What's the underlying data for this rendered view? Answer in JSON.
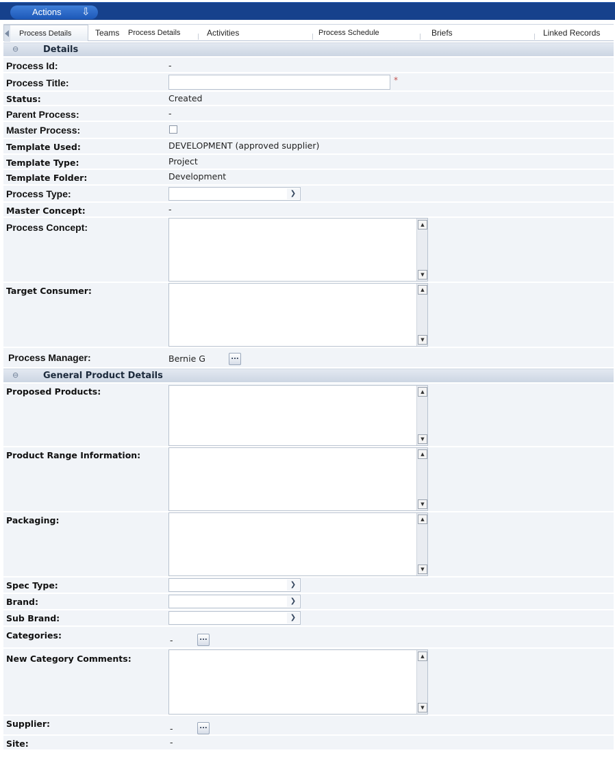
{
  "toolbar": {
    "actions_label": "Actions",
    "actions_icon": "down-arrow-icon"
  },
  "tabs": [
    {
      "label": "Process Details",
      "active": true
    },
    {
      "label": "Teams"
    },
    {
      "label": "Process Details"
    },
    {
      "label": "Activities"
    },
    {
      "label": "Process Schedule"
    },
    {
      "label": "Briefs"
    },
    {
      "label": "Linked Records"
    }
  ],
  "sections": {
    "details": {
      "title": "Details"
    },
    "general": {
      "title": "General Product Details"
    }
  },
  "fields": {
    "process_id": {
      "label": "Process Id:",
      "value": "-"
    },
    "process_title": {
      "label": "Process Title:",
      "value": "",
      "required_mark": "*"
    },
    "status": {
      "label": "Status:",
      "value": "Created"
    },
    "parent_process": {
      "label": "Parent Process:",
      "value": "-"
    },
    "master_process": {
      "label": "Master Process:",
      "checked": false
    },
    "template_used": {
      "label": "Template Used:",
      "value": "DEVELOPMENT (approved supplier)"
    },
    "template_type": {
      "label": "Template Type:",
      "value": "Project"
    },
    "template_folder": {
      "label": "Template Folder:",
      "value": "Development"
    },
    "process_type": {
      "label": "Process Type:",
      "value": ""
    },
    "master_concept": {
      "label": "Master Concept:",
      "value": "-"
    },
    "process_concept": {
      "label": "Process Concept:",
      "value": ""
    },
    "target_consumer": {
      "label": "Target Consumer:",
      "value": ""
    },
    "process_manager": {
      "label": "Process Manager:",
      "value": "Bernie G",
      "picker": "..."
    },
    "proposed_products": {
      "label": "Proposed Products:",
      "value": ""
    },
    "product_range_information": {
      "label": "Product Range Information:",
      "value": ""
    },
    "packaging": {
      "label": "Packaging:",
      "value": ""
    },
    "spec_type": {
      "label": "Spec Type:",
      "value": ""
    },
    "brand": {
      "label": "Brand:",
      "value": ""
    },
    "sub_brand": {
      "label": "Sub Brand:",
      "value": ""
    },
    "categories": {
      "label": "Categories:",
      "value": "-",
      "picker": "..."
    },
    "new_category_comments": {
      "label": "New Category Comments:",
      "value": ""
    },
    "supplier": {
      "label": "Supplier:",
      "value": "-",
      "picker": "..."
    },
    "site": {
      "label": "Site:",
      "value": "-"
    }
  },
  "colors": {
    "toolbar": "#16418c",
    "row": "#f1f4f8",
    "section": "#d7dfea",
    "required": "#c0504d"
  }
}
